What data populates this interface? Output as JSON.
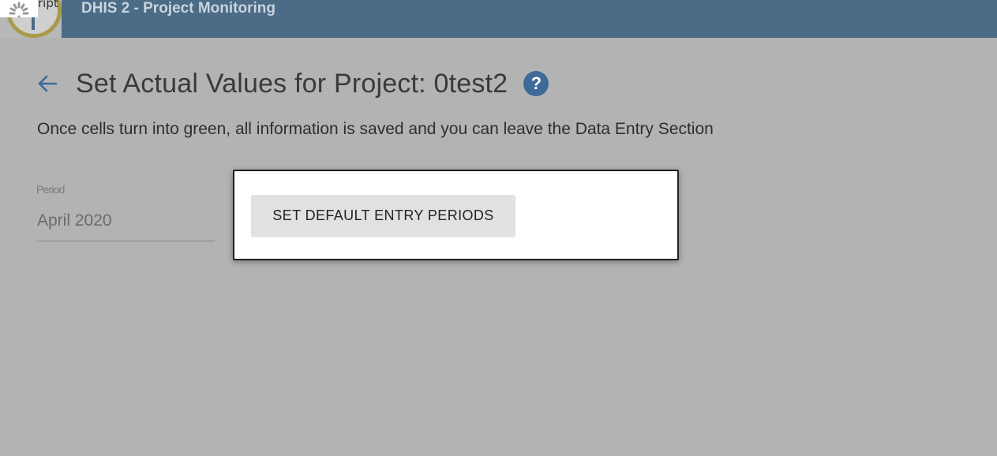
{
  "header": {
    "app_title": "DHIS 2 - Project Monitoring",
    "broken_image_alt": "ript",
    "bar_color": "#4b6b86"
  },
  "page": {
    "back_icon": "arrow-left-icon",
    "title": "Set Actual Values for Project: 0test2",
    "help_icon": "question-circle-icon",
    "help_glyph": "?",
    "info": "Once cells turn into green, all information is saved and you can leave the Data Entry Section"
  },
  "period": {
    "label": "Period",
    "value": "April 2020"
  },
  "dialog": {
    "button_label": "SET DEFAULT ENTRY PERIODS"
  },
  "colors": {
    "overlay_bg": "#b3b3b3",
    "accent_blue": "#3d6a99"
  }
}
